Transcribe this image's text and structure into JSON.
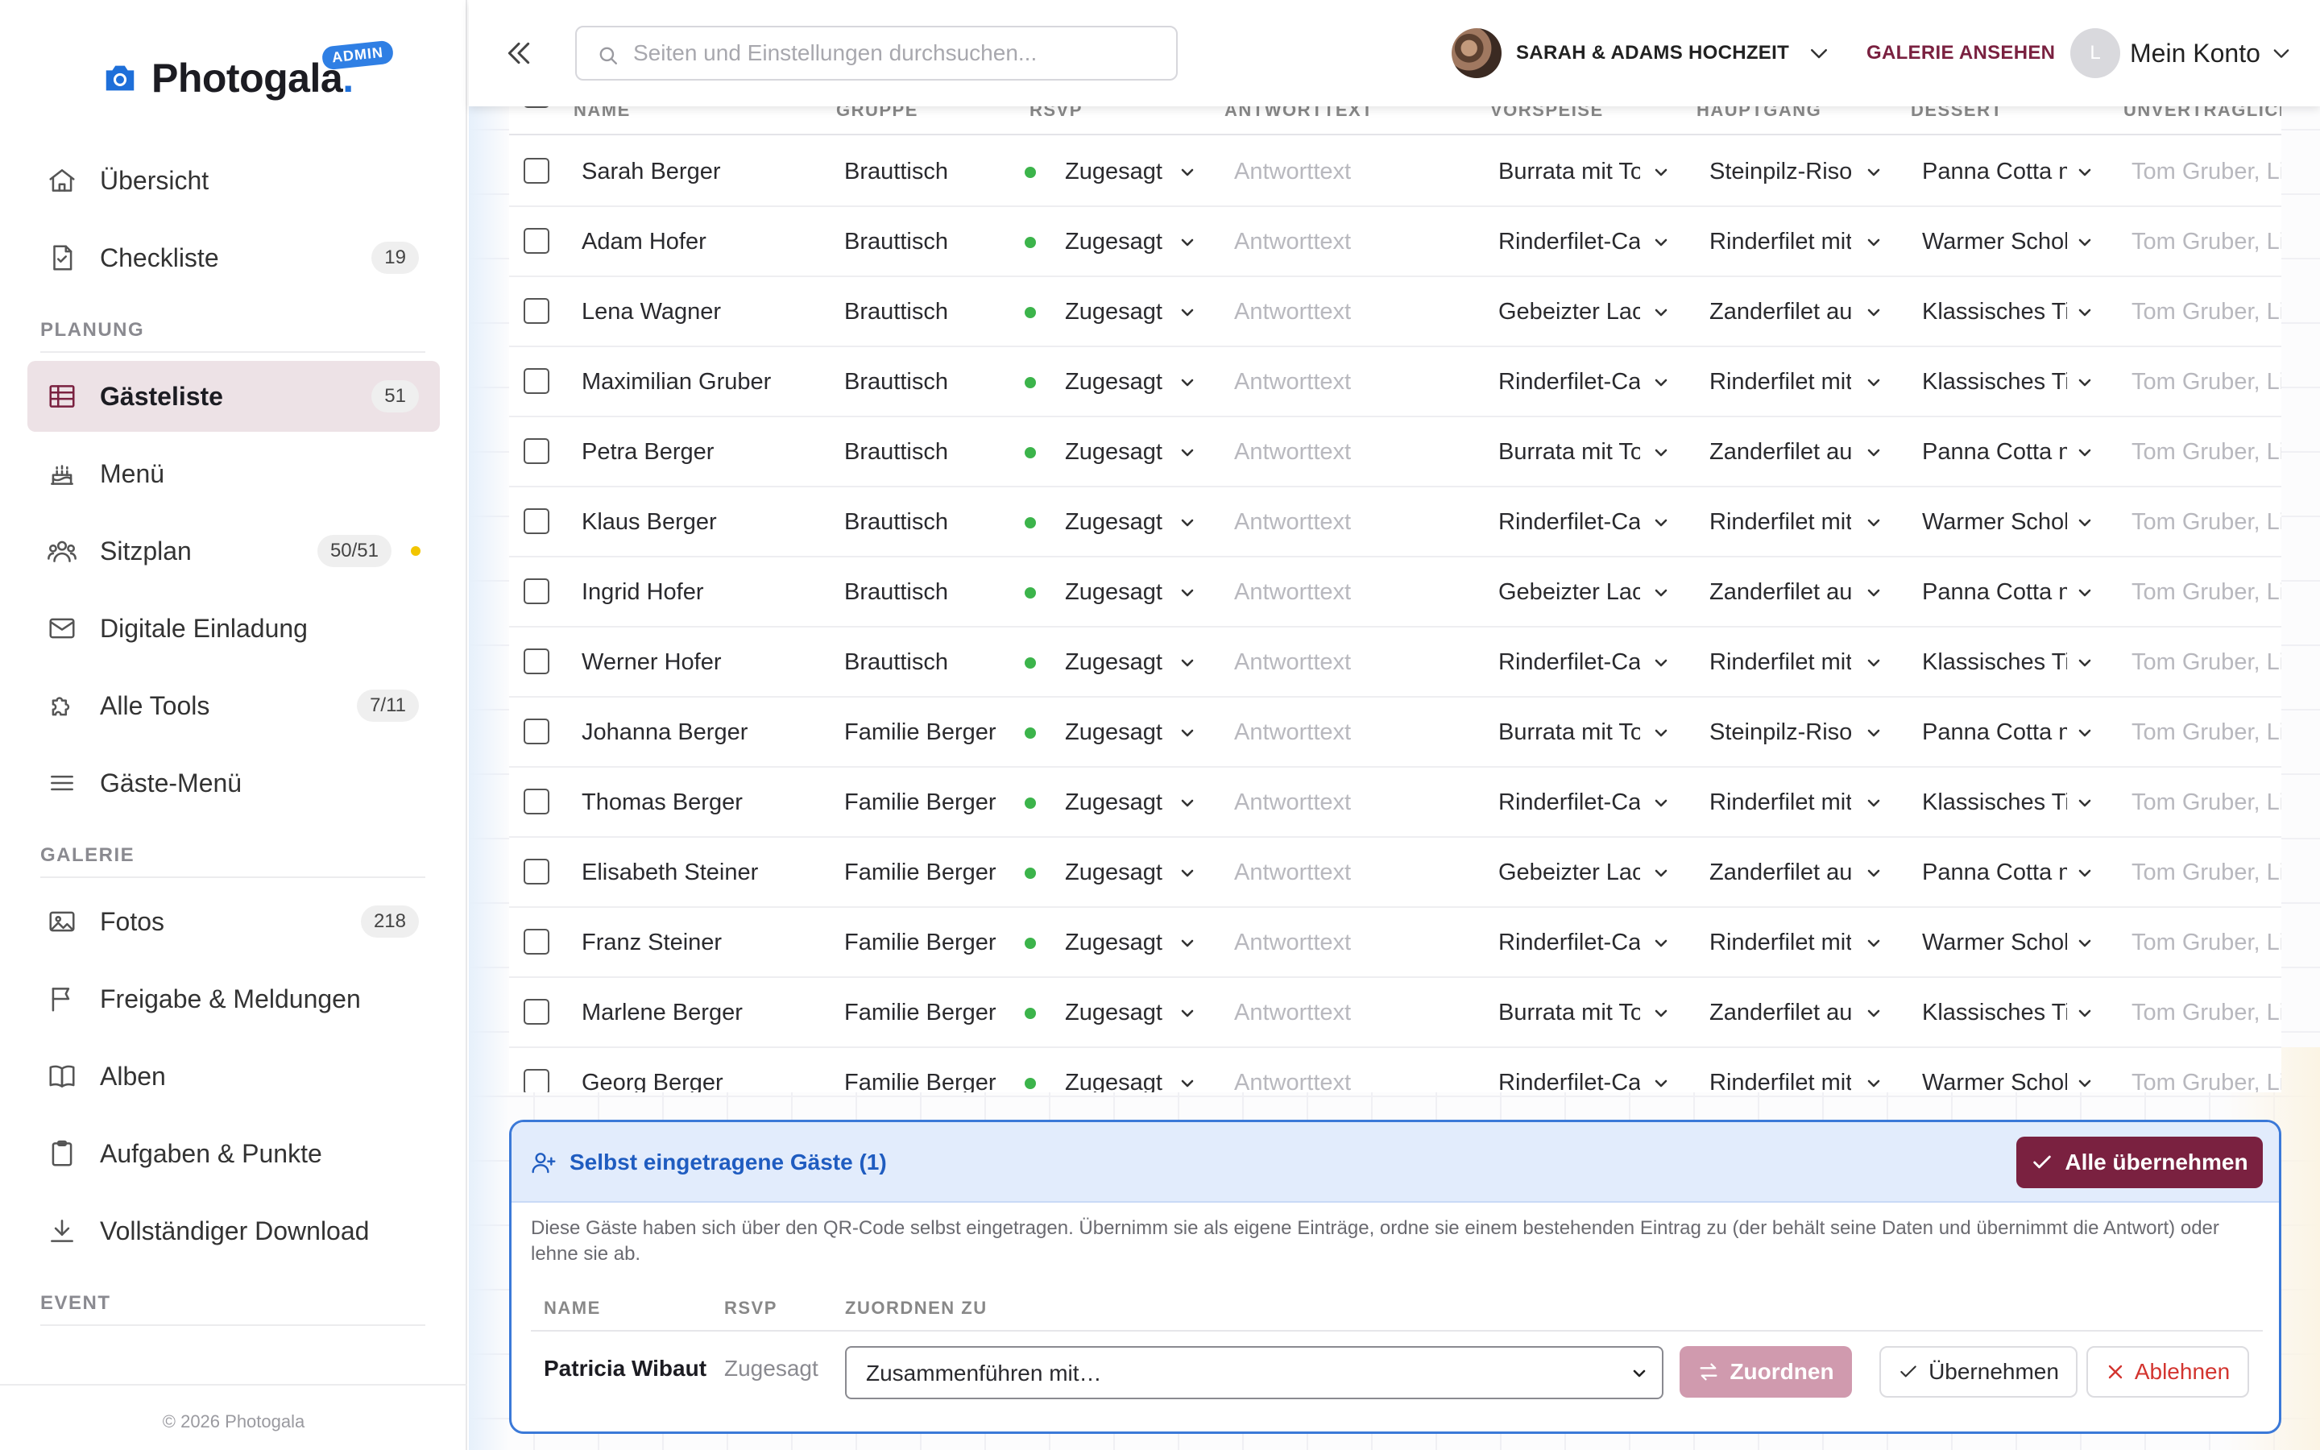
{
  "brand": {
    "name": "Photogala",
    "dot": ".",
    "badge": "ADMIN"
  },
  "sidebar": {
    "top_items": [
      {
        "label": "Übersicht",
        "icon": "home-icon"
      },
      {
        "label": "Checkliste",
        "icon": "checklist-icon",
        "badge": "19"
      }
    ],
    "sections": [
      {
        "title": "PLANUNG",
        "items": [
          {
            "label": "Gästeliste",
            "icon": "table-icon",
            "badge": "51",
            "active": true
          },
          {
            "label": "Menü",
            "icon": "cake-icon"
          },
          {
            "label": "Sitzplan",
            "icon": "people-icon",
            "badge": "50/51",
            "dot": true
          },
          {
            "label": "Digitale Einladung",
            "icon": "envelope-icon"
          },
          {
            "label": "Alle Tools",
            "icon": "puzzle-icon",
            "badge": "7/11"
          },
          {
            "label": "Gäste-Menü",
            "icon": "menu-icon"
          }
        ]
      },
      {
        "title": "GALERIE",
        "items": [
          {
            "label": "Fotos",
            "icon": "image-icon",
            "badge": "218"
          },
          {
            "label": "Freigabe & Meldungen",
            "icon": "flag-icon"
          },
          {
            "label": "Alben",
            "icon": "book-icon"
          },
          {
            "label": "Aufgaben & Punkte",
            "icon": "clipboard-icon"
          },
          {
            "label": "Vollständiger Download",
            "icon": "download-icon"
          }
        ]
      },
      {
        "title": "EVENT",
        "items": []
      }
    ],
    "copyright": "© 2026 Photogala"
  },
  "topbar": {
    "search_placeholder": "Seiten und Einstellungen durchsuchen...",
    "event_name": "SARAH & ADAMS HOCHZEIT",
    "gallery_link": "GALERIE ANSEHEN",
    "account_initial": "L",
    "account_label": "Mein Konto"
  },
  "guest_table": {
    "columns": [
      "NAME",
      "GRUPPE",
      "RSVP",
      "ANTWORTTEXT",
      "VORSPEISE",
      "HAUPTGANG",
      "DESSERT",
      "UNVERTRÄGLICHKEITEN"
    ],
    "answer_placeholder": "Antworttext",
    "rows": [
      {
        "name": "Sarah Berger",
        "group": "Brauttisch",
        "rsvp": "Zugesagt",
        "starter": "Burrata mit To",
        "main": "Steinpilz-Risot",
        "dessert": "Panna Cotta m",
        "extra": "Tom Gruber, Lis"
      },
      {
        "name": "Adam Hofer",
        "group": "Brauttisch",
        "rsvp": "Zugesagt",
        "starter": "Rinderfilet-Car",
        "main": "Rinderfilet mit",
        "dessert": "Warmer Schok",
        "extra": "Tom Gruber, Lis"
      },
      {
        "name": "Lena Wagner",
        "group": "Brauttisch",
        "rsvp": "Zugesagt",
        "starter": "Gebeizter Lacl",
        "main": "Zanderfilet aut",
        "dessert": "Klassisches Ti",
        "extra": "Tom Gruber, Lis"
      },
      {
        "name": "Maximilian Gruber",
        "group": "Brauttisch",
        "rsvp": "Zugesagt",
        "starter": "Rinderfilet-Car",
        "main": "Rinderfilet mit",
        "dessert": "Klassisches Ti",
        "extra": "Tom Gruber, Lis"
      },
      {
        "name": "Petra Berger",
        "group": "Brauttisch",
        "rsvp": "Zugesagt",
        "starter": "Burrata mit To",
        "main": "Zanderfilet aut",
        "dessert": "Panna Cotta m",
        "extra": "Tom Gruber, Lis"
      },
      {
        "name": "Klaus Berger",
        "group": "Brauttisch",
        "rsvp": "Zugesagt",
        "starter": "Rinderfilet-Car",
        "main": "Rinderfilet mit",
        "dessert": "Warmer Schok",
        "extra": "Tom Gruber, Lis"
      },
      {
        "name": "Ingrid Hofer",
        "group": "Brauttisch",
        "rsvp": "Zugesagt",
        "starter": "Gebeizter Lacl",
        "main": "Zanderfilet aut",
        "dessert": "Panna Cotta m",
        "extra": "Tom Gruber, Lis"
      },
      {
        "name": "Werner Hofer",
        "group": "Brauttisch",
        "rsvp": "Zugesagt",
        "starter": "Rinderfilet-Car",
        "main": "Rinderfilet mit",
        "dessert": "Klassisches Ti",
        "extra": "Tom Gruber, Lis"
      },
      {
        "name": "Johanna Berger",
        "group": "Familie Berger",
        "rsvp": "Zugesagt",
        "starter": "Burrata mit To",
        "main": "Steinpilz-Risot",
        "dessert": "Panna Cotta m",
        "extra": "Tom Gruber, Lis"
      },
      {
        "name": "Thomas Berger",
        "group": "Familie Berger",
        "rsvp": "Zugesagt",
        "starter": "Rinderfilet-Car",
        "main": "Rinderfilet mit",
        "dessert": "Klassisches Ti",
        "extra": "Tom Gruber, Lis"
      },
      {
        "name": "Elisabeth Steiner",
        "group": "Familie Berger",
        "rsvp": "Zugesagt",
        "starter": "Gebeizter Lacl",
        "main": "Zanderfilet aut",
        "dessert": "Panna Cotta m",
        "extra": "Tom Gruber, Lis"
      },
      {
        "name": "Franz Steiner",
        "group": "Familie Berger",
        "rsvp": "Zugesagt",
        "starter": "Rinderfilet-Car",
        "main": "Rinderfilet mit",
        "dessert": "Warmer Schok",
        "extra": "Tom Gruber, Lis"
      },
      {
        "name": "Marlene Berger",
        "group": "Familie Berger",
        "rsvp": "Zugesagt",
        "starter": "Burrata mit To",
        "main": "Zanderfilet aut",
        "dessert": "Klassisches Ti",
        "extra": "Tom Gruber, Lis"
      },
      {
        "name": "Georg Berger",
        "group": "Familie Berger",
        "rsvp": "Zugesagt",
        "starter": "Rinderfilet-Car",
        "main": "Rinderfilet mit",
        "dessert": "Warmer Schok",
        "extra": "Tom Gruber, Lis"
      }
    ]
  },
  "self_registered": {
    "title": "Selbst eingetragene Gäste (1)",
    "accept_all": "Alle übernehmen",
    "description": "Diese Gäste haben sich über den QR-Code selbst eingetragen. Übernimm sie als eigene Einträge, ordne sie einem bestehenden Eintrag zu (der behält seine Daten und übernimmt die Antwort) oder lehne sie ab.",
    "columns": {
      "name": "NAME",
      "rsvp": "RSVP",
      "assign": "ZUORDNEN ZU"
    },
    "guest": {
      "name": "Patricia Wibaut",
      "rsvp": "Zugesagt"
    },
    "merge_select": "Zusammenführen mit…",
    "assign_button": "Zuordnen",
    "take_button": "Übernehmen",
    "reject_button": "Ablehnen"
  },
  "colors": {
    "accent": "#7a2140",
    "accent_light": "#ede2e6",
    "primary_blue": "#1e6fd9",
    "success_green": "#3cb44b",
    "danger_red": "#d3342f"
  }
}
